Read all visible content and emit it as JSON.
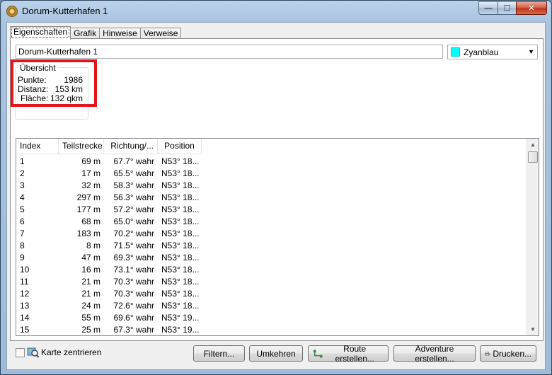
{
  "window": {
    "title": "Dorum-Kutterhafen 1",
    "controls": {
      "minimize": "—",
      "maximize": "☐",
      "close": "✕"
    }
  },
  "tabs": [
    {
      "label": "Eigenschaften",
      "active": true
    },
    {
      "label": "Grafik",
      "active": false
    },
    {
      "label": "Hinweise",
      "active": false
    },
    {
      "label": "Verweise",
      "active": false
    }
  ],
  "properties": {
    "name_value": "Dorum-Kutterhafen 1",
    "color": {
      "label": "Zyanblau",
      "hex": "#00ffff"
    }
  },
  "overview": {
    "title": "Übersicht",
    "rows": [
      {
        "label": "Punkte:",
        "value": "1986"
      },
      {
        "label": "Distanz:",
        "value": "153 km"
      },
      {
        "label": "Fläche:",
        "value": "132 qkm"
      }
    ],
    "highlight_color": "#e3151b"
  },
  "table": {
    "columns": [
      "Index",
      "Teilstrecke",
      "Richtung/...",
      "Position"
    ],
    "rows": [
      [
        "1",
        "69 m",
        "67.7° wahr",
        "N53° 18..."
      ],
      [
        "2",
        "17 m",
        "65.5° wahr",
        "N53° 18..."
      ],
      [
        "3",
        "32 m",
        "58.3° wahr",
        "N53° 18..."
      ],
      [
        "4",
        "297 m",
        "56.3° wahr",
        "N53° 18..."
      ],
      [
        "5",
        "177 m",
        "57.2° wahr",
        "N53° 18..."
      ],
      [
        "6",
        "68 m",
        "65.0° wahr",
        "N53° 18..."
      ],
      [
        "7",
        "183 m",
        "70.2° wahr",
        "N53° 18..."
      ],
      [
        "8",
        "8 m",
        "71.5° wahr",
        "N53° 18..."
      ],
      [
        "9",
        "47 m",
        "69.3° wahr",
        "N53° 18..."
      ],
      [
        "10",
        "16 m",
        "73.1° wahr",
        "N53° 18..."
      ],
      [
        "11",
        "21 m",
        "70.3° wahr",
        "N53° 18..."
      ],
      [
        "12",
        "21 m",
        "70.3° wahr",
        "N53° 18..."
      ],
      [
        "13",
        "24 m",
        "72.6° wahr",
        "N53° 18..."
      ],
      [
        "14",
        "55 m",
        "69.6° wahr",
        "N53° 19..."
      ],
      [
        "15",
        "25 m",
        "67.3° wahr",
        "N53° 19..."
      ]
    ]
  },
  "footer": {
    "center_map_label": "Karte zentrieren",
    "buttons": {
      "filter": "Filtern...",
      "reverse": "Umkehren",
      "create_route": "Route erstellen...",
      "create_adventure": "Adventure erstellen...",
      "print": "Drucken..."
    }
  }
}
